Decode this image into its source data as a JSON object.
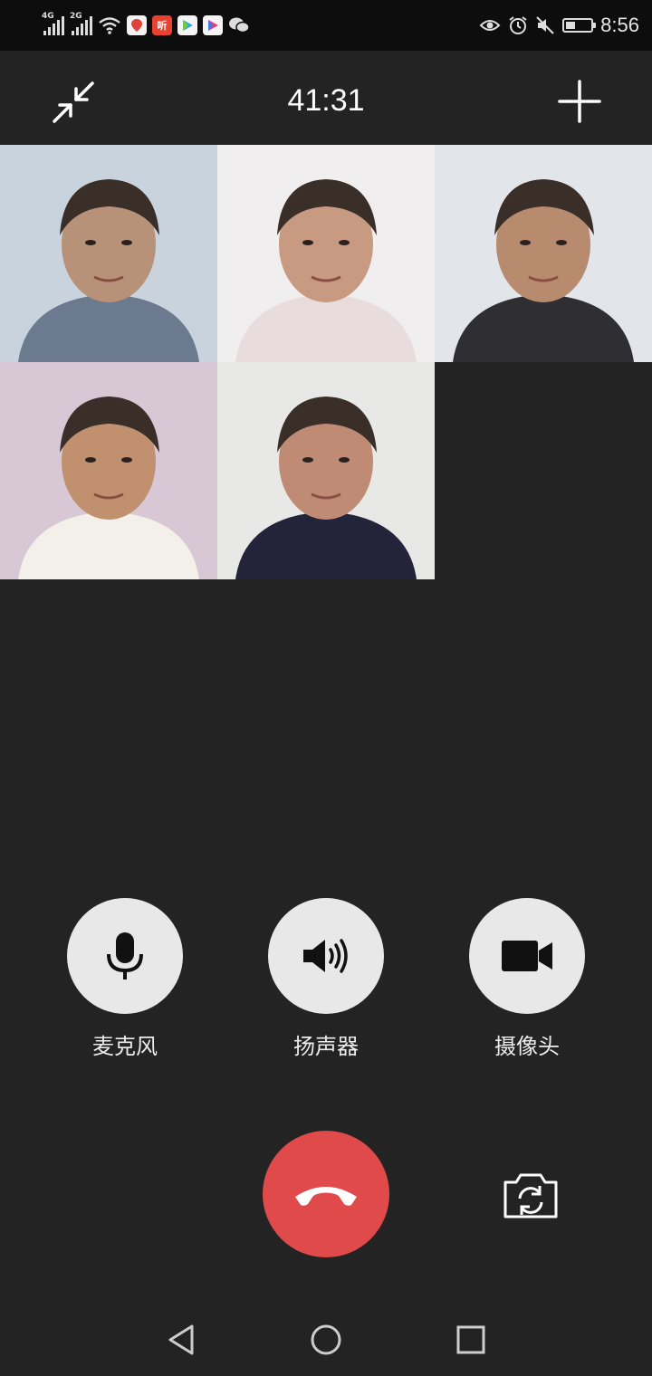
{
  "status_bar": {
    "network_1": "4G",
    "network_2": "2G",
    "app_icons": [
      "location-app-icon",
      "ting-app-icon",
      "video-app-icon",
      "youku-app-icon",
      "wechat-icon"
    ],
    "listen_app_glyph": "听",
    "time": "8:56",
    "battery_level": 0.4
  },
  "call": {
    "timer": "41:31",
    "participants": [
      {
        "slot": 1,
        "palette": [
          "#c8d3de",
          "#b89278",
          "#6b7a8e"
        ]
      },
      {
        "slot": 2,
        "palette": [
          "#f0eeee",
          "#c99a82",
          "#e8dcdc"
        ]
      },
      {
        "slot": 3,
        "palette": [
          "#e2e5ea",
          "#b88a6e",
          "#2f2f33"
        ]
      },
      {
        "slot": 4,
        "palette": [
          "#d8c8d6",
          "#c0906f",
          "#f3efe9"
        ]
      },
      {
        "slot": 5,
        "palette": [
          "#e8e8e6",
          "#c08b74",
          "#23233a"
        ]
      }
    ]
  },
  "controls": {
    "microphone": "麦克风",
    "speaker": "扬声器",
    "camera": "摄像头"
  },
  "colors": {
    "background": "#232323",
    "hangup": "#e04a4a",
    "control_circle": "#e8e8e8"
  }
}
